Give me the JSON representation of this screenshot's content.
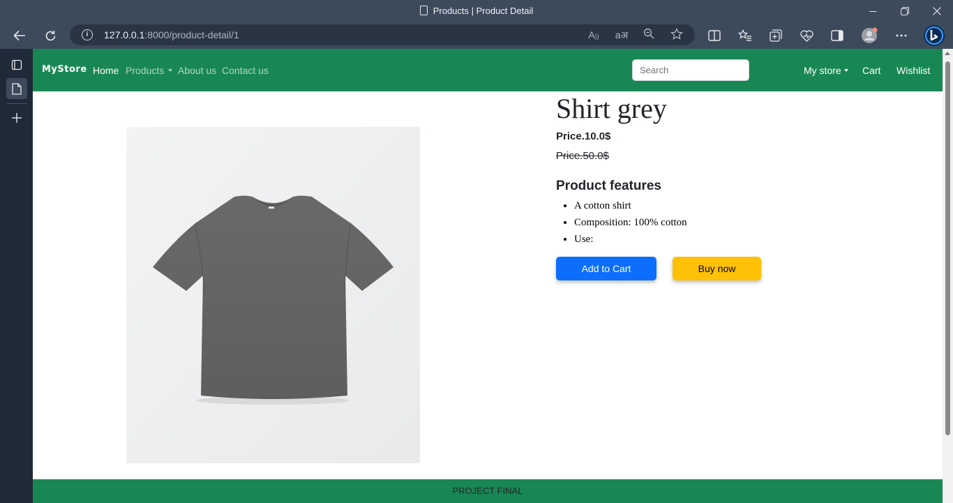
{
  "browser": {
    "tab_title": "Products | Product Detail",
    "url_host": "127.0.0.1",
    "url_path": ":8000/product-detail/1"
  },
  "navbar": {
    "brand": "MyStore",
    "links": {
      "home": "Home",
      "products": "Products",
      "about": "About us",
      "contact": "Contact us"
    },
    "search_placeholder": "Search",
    "right": {
      "my_store": "My store",
      "cart": "Cart",
      "wishlist": "Wishlist"
    }
  },
  "product": {
    "name": "Shirt grey",
    "price": "Price.10.0$",
    "old_price": "Price.50.0$",
    "features_heading": "Product features",
    "features": [
      "A cotton shirt",
      "Composition: 100% cotton",
      "Use:"
    ],
    "add_to_cart": "Add to Cart",
    "buy_now": "Buy now",
    "image_icon": "grey-tshirt-image"
  },
  "footer": {
    "text": "PROJECT FINAL"
  },
  "colors": {
    "navbar": "#198754",
    "primary_button": "#0d6efd",
    "warning_button": "#ffc107",
    "browser_chrome": "#3c4a5c"
  }
}
